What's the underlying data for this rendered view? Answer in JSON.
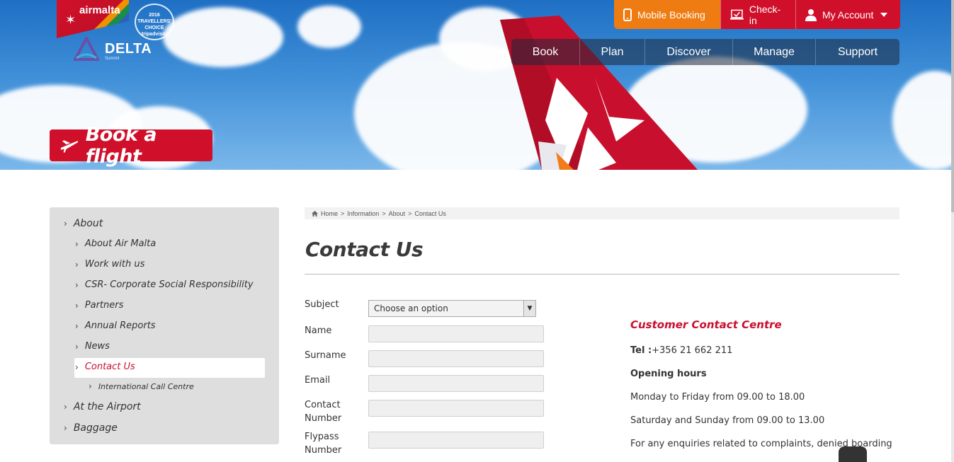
{
  "brand": {
    "airline": "airmalta",
    "tripadvisor": [
      "2016",
      "TRAVELLERS'",
      "CHOICE",
      "tripadvisor"
    ],
    "delta_name": "DELTA",
    "delta_sub": "Summit"
  },
  "utility_nav": {
    "mobile_booking": "Mobile Booking",
    "check_in": "Check-in",
    "my_account": "My Account"
  },
  "main_nav": [
    "Book",
    "Plan",
    "Discover",
    "Manage",
    "Support"
  ],
  "book_flight": "Book a flight",
  "sidebar": {
    "items": [
      {
        "label": "About",
        "level": 1
      },
      {
        "label": "About Air Malta",
        "level": 2
      },
      {
        "label": "Work with us",
        "level": 2
      },
      {
        "label": "CSR- Corporate Social Responsibility",
        "level": 2
      },
      {
        "label": "Partners",
        "level": 2
      },
      {
        "label": "Annual Reports",
        "level": 2
      },
      {
        "label": "News",
        "level": 2
      },
      {
        "label": "Contact Us",
        "level": 2,
        "active": true
      },
      {
        "label": "International Call Centre",
        "level": 3
      },
      {
        "label": "At the Airport",
        "level": 1
      },
      {
        "label": "Baggage",
        "level": 1
      }
    ]
  },
  "breadcrumb": [
    "Home",
    ">",
    "Information",
    ">",
    "About",
    ">",
    "Contact Us"
  ],
  "page_title": "Contact Us",
  "form": {
    "subject_label": "Subject",
    "subject_value": "Choose an option",
    "name_label": "Name",
    "surname_label": "Surname",
    "email_label": "Email",
    "contact_label": [
      "Contact",
      "Number"
    ],
    "flypass_label": [
      "Flypass",
      "Number"
    ]
  },
  "contact_info": {
    "heading": "Customer Contact Centre",
    "tel_label": "Tel :",
    "tel_value": "+356 21 662 211",
    "hours_heading": "Opening hours",
    "weekday": "Monday to Friday from 09.00 to 18.00",
    "weekend": "Saturday and Sunday from 09.00 to 13.00",
    "enquiries": "For any enquiries related to complaints, denied boarding"
  },
  "colors": {
    "brand_red": "#d0102a",
    "mobile_orange": "#ef7c12",
    "text_red": "#c8102e"
  },
  "icons": [
    "phone-icon",
    "laptop-check-icon",
    "user-icon",
    "plane-icon",
    "home-icon",
    "chevron-right-icon",
    "caret-down-icon"
  ]
}
